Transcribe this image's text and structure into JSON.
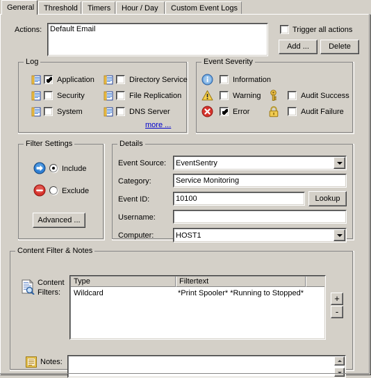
{
  "tabs": [
    {
      "label": "General",
      "selected": true
    },
    {
      "label": "Threshold",
      "selected": false
    },
    {
      "label": "Timers",
      "selected": false
    },
    {
      "label": "Hour / Day",
      "selected": false
    },
    {
      "label": "Custom Event Logs",
      "selected": false
    }
  ],
  "actions": {
    "label": "Actions:",
    "value": "Default Email",
    "trigger_all_label": "Trigger all actions",
    "trigger_all_checked": false,
    "add_label": "Add ...",
    "delete_label": "Delete"
  },
  "log": {
    "title": "Log",
    "items": [
      {
        "label": "Application",
        "checked": true,
        "icon": "event-log-icon"
      },
      {
        "label": "Security",
        "checked": false,
        "icon": "event-log-icon"
      },
      {
        "label": "System",
        "checked": false,
        "icon": "event-log-icon"
      },
      {
        "label": "Directory Service",
        "checked": false,
        "icon": "event-log-icon"
      },
      {
        "label": "File Replication",
        "checked": false,
        "icon": "event-log-icon"
      },
      {
        "label": "DNS Server",
        "checked": false,
        "icon": "event-log-icon"
      }
    ],
    "more_label": "more ...",
    "link_color": "#0000cd"
  },
  "severity": {
    "title": "Event Severity",
    "items": [
      {
        "label": "Information",
        "checked": false,
        "icon": "information-icon",
        "color": "#3a7fd5"
      },
      {
        "label": "Warning",
        "checked": false,
        "icon": "warning-icon",
        "color": "#f2c12e"
      },
      {
        "label": "Error",
        "checked": true,
        "icon": "error-icon",
        "color": "#d62b25"
      },
      {
        "label": "Audit Success",
        "checked": false,
        "icon": "key-icon",
        "color": "#e8b83a"
      },
      {
        "label": "Audit Failure",
        "checked": false,
        "icon": "lock-icon",
        "color": "#e8b83a"
      }
    ]
  },
  "filter_settings": {
    "title": "Filter Settings",
    "include_label": "Include",
    "exclude_label": "Exclude",
    "selected": "include",
    "include_icon": "blue-arrow-right-icon",
    "exclude_icon": "red-minus-circle-icon",
    "advanced_label": "Advanced ..."
  },
  "details": {
    "title": "Details",
    "fields": [
      {
        "label": "Event Source:",
        "value": "EventSentry",
        "type": "combobox"
      },
      {
        "label": "Category:",
        "value": "Service Monitoring",
        "type": "textbox"
      },
      {
        "label": "Event ID:",
        "value": "10100",
        "type": "textbox"
      },
      {
        "label": "Username:",
        "value": "",
        "type": "textbox"
      },
      {
        "label": "Computer:",
        "value": "HOST1",
        "type": "combobox"
      }
    ],
    "lookup_label": "Lookup"
  },
  "content_filter": {
    "title": "Content Filter & Notes",
    "filters_label_line1": "Content",
    "filters_label_line2": "Filters:",
    "filters_icon": "document-search-icon",
    "columns": [
      "Type",
      "Filtertext",
      ""
    ],
    "rows": [
      {
        "type": "Wildcard",
        "filtertext": "*Print Spooler* *Running to Stopped*"
      }
    ],
    "add_button": "+",
    "remove_button": "-",
    "notes_label": "Notes:",
    "notes_icon": "notes-icon",
    "notes_value": ""
  }
}
